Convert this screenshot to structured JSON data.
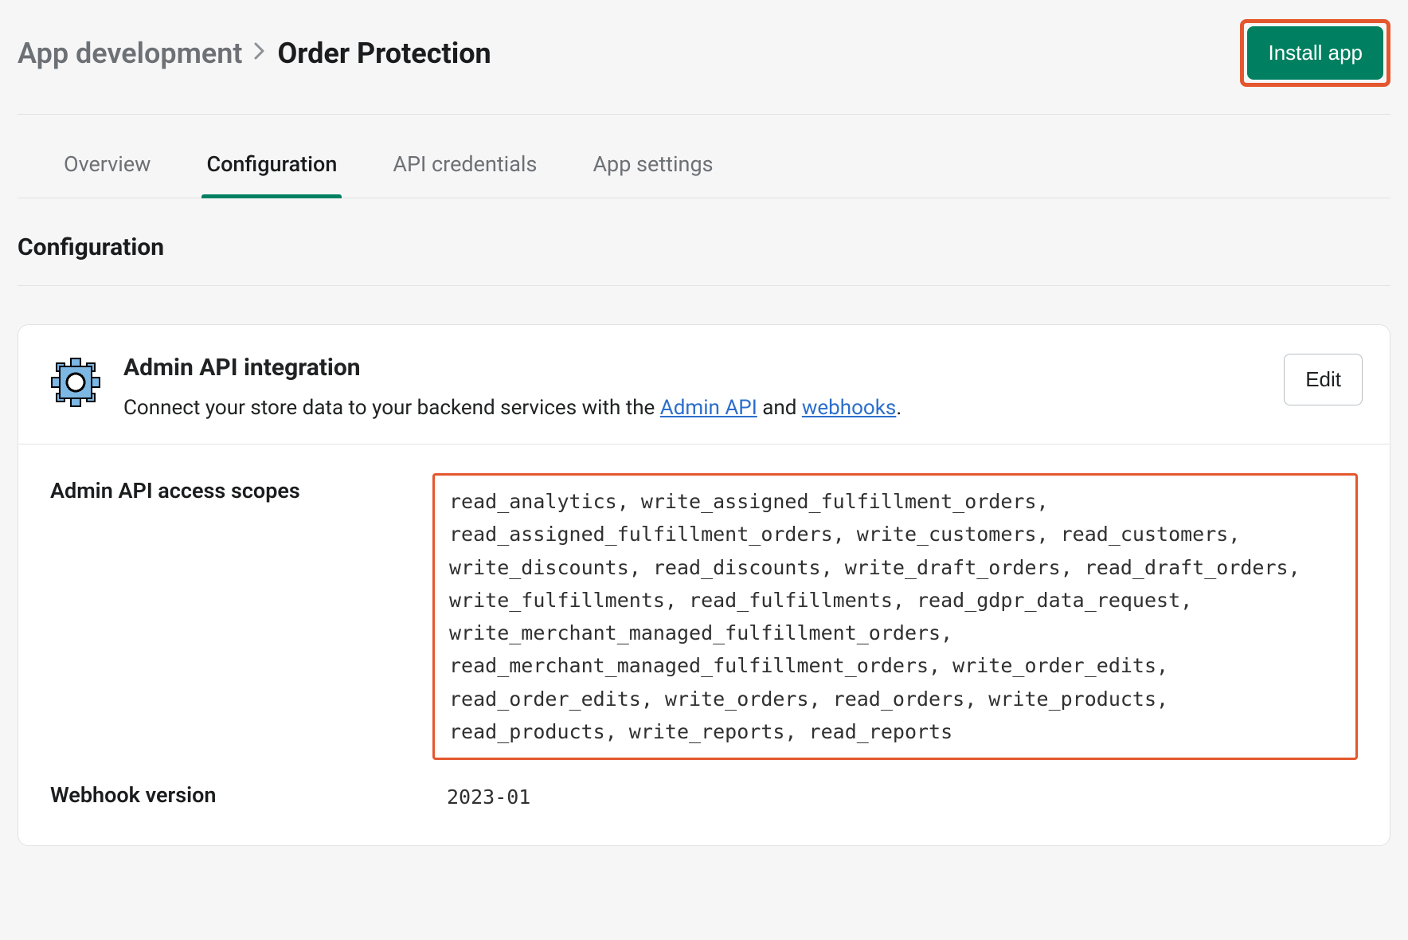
{
  "breadcrumb": {
    "parent": "App development",
    "current": "Order Protection"
  },
  "install_button": "Install app",
  "tabs": [
    {
      "label": "Overview",
      "active": false
    },
    {
      "label": "Configuration",
      "active": true
    },
    {
      "label": "API credentials",
      "active": false
    },
    {
      "label": "App settings",
      "active": false
    }
  ],
  "section_title": "Configuration",
  "card": {
    "title": "Admin API integration",
    "desc_prefix": "Connect your store data to your backend services with the ",
    "link1": "Admin API",
    "desc_mid": " and ",
    "link2": "webhooks",
    "desc_suffix": ".",
    "edit": "Edit"
  },
  "rows": {
    "scopes_label": "Admin API access scopes",
    "scopes_value": "read_analytics, write_assigned_fulfillment_orders, read_assigned_fulfillment_orders, write_customers, read_customers, write_discounts, read_discounts, write_draft_orders, read_draft_orders, write_fulfillments, read_fulfillments, read_gdpr_data_request, write_merchant_managed_fulfillment_orders, read_merchant_managed_fulfillment_orders, write_order_edits, read_order_edits, write_orders, read_orders, write_products, read_products, write_reports, read_reports",
    "webhook_label": "Webhook version",
    "webhook_value": "2023-01"
  },
  "highlight_color": "#e4572e",
  "accent_color": "#008060"
}
